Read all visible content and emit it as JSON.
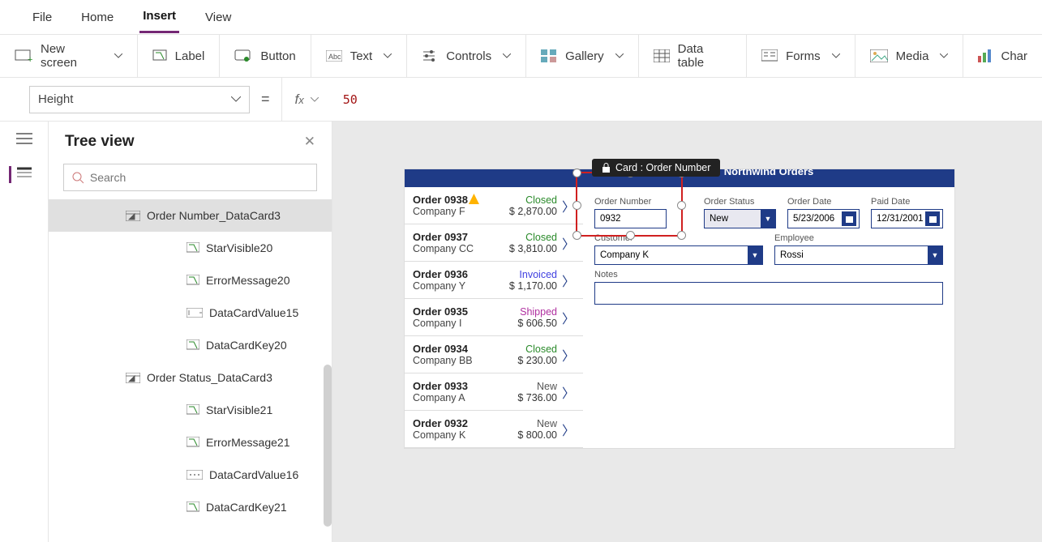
{
  "menubar": {
    "file": "File",
    "home": "Home",
    "insert": "Insert",
    "view": "View"
  },
  "ribbon": {
    "new_screen": "New screen",
    "label": "Label",
    "button": "Button",
    "text": "Text",
    "controls": "Controls",
    "gallery": "Gallery",
    "data_table": "Data table",
    "forms": "Forms",
    "media": "Media",
    "chart": "Char"
  },
  "formula": {
    "property": "Height",
    "value": "50"
  },
  "tree": {
    "title": "Tree view",
    "search_placeholder": "Search",
    "nodes": [
      {
        "label": "Order Number_DataCard3",
        "type": "card",
        "expanded": true,
        "children": [
          {
            "label": "StarVisible20",
            "type": "label"
          },
          {
            "label": "ErrorMessage20",
            "type": "label"
          },
          {
            "label": "DataCardValue15",
            "type": "input"
          },
          {
            "label": "DataCardKey20",
            "type": "label"
          }
        ]
      },
      {
        "label": "Order Status_DataCard3",
        "type": "card",
        "expanded": true,
        "children": [
          {
            "label": "StarVisible21",
            "type": "label"
          },
          {
            "label": "ErrorMessage21",
            "type": "label"
          },
          {
            "label": "DataCardValue16",
            "type": "dropdown"
          },
          {
            "label": "DataCardKey21",
            "type": "label"
          }
        ]
      }
    ]
  },
  "selection_tooltip": "Card : Order Number",
  "app": {
    "header": "Northwind Orders",
    "gallery": [
      {
        "order": "Order 0938",
        "company": "Company F",
        "status": "Closed",
        "amount": "$ 2,870.00",
        "warn": true
      },
      {
        "order": "Order 0937",
        "company": "Company CC",
        "status": "Closed",
        "amount": "$ 3,810.00"
      },
      {
        "order": "Order 0936",
        "company": "Company Y",
        "status": "Invoiced",
        "amount": "$ 1,170.00"
      },
      {
        "order": "Order 0935",
        "company": "Company I",
        "status": "Shipped",
        "amount": "$ 606.50"
      },
      {
        "order": "Order 0934",
        "company": "Company BB",
        "status": "Closed",
        "amount": "$ 230.00"
      },
      {
        "order": "Order 0933",
        "company": "Company A",
        "status": "New",
        "amount": "$ 736.00"
      },
      {
        "order": "Order 0932",
        "company": "Company K",
        "status": "New",
        "amount": "$ 800.00"
      }
    ],
    "form": {
      "labels": {
        "order_number": "Order Number",
        "order_status": "Order Status",
        "order_date": "Order Date",
        "paid_date": "Paid Date",
        "customer": "Customer",
        "employee": "Employee",
        "notes": "Notes"
      },
      "values": {
        "order_number": "0932",
        "order_status": "New",
        "order_date": "5/23/2006",
        "paid_date": "12/31/2001",
        "customer": "Company K",
        "employee": "Rossi"
      }
    }
  }
}
